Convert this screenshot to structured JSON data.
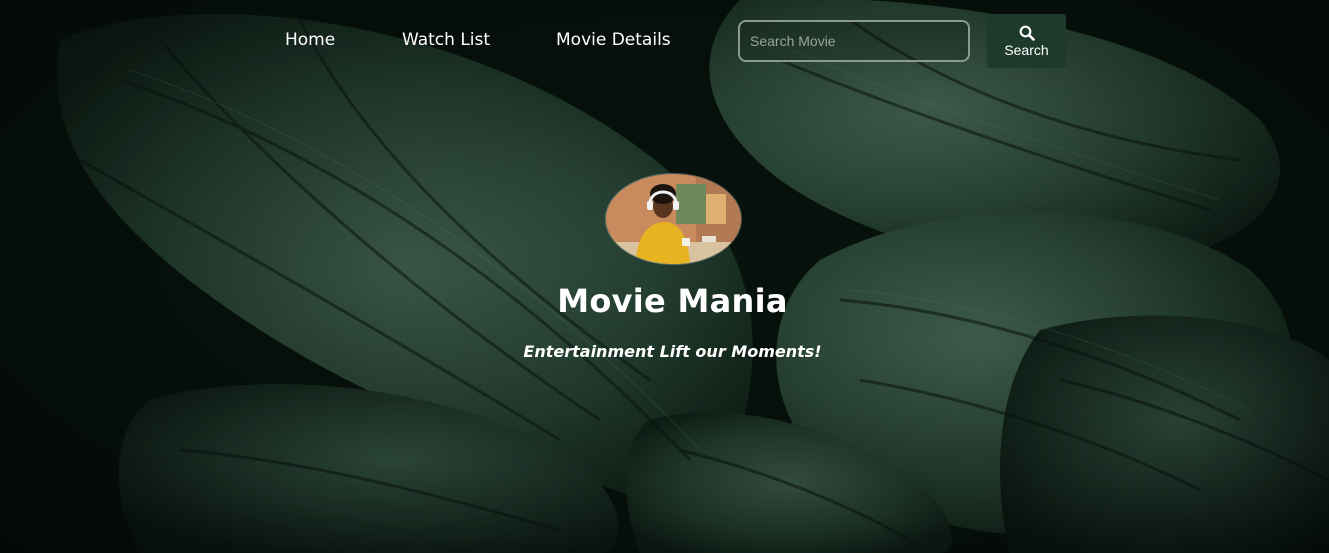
{
  "nav": {
    "links": [
      {
        "label": "Home"
      },
      {
        "label": "Watch List"
      },
      {
        "label": "Movie Details"
      }
    ],
    "search": {
      "placeholder": "Search Movie",
      "button_label": "Search",
      "button_icon": "search-icon"
    }
  },
  "hero": {
    "avatar": "person-with-headphones-photo",
    "title": "Movie Mania",
    "tagline": "Entertainment Lift our Moments!"
  },
  "colors": {
    "background": "#0c1a12",
    "leaf": "#2c4a3a",
    "search_button_bg": "#1e3a2c",
    "text": "#ffffff"
  }
}
